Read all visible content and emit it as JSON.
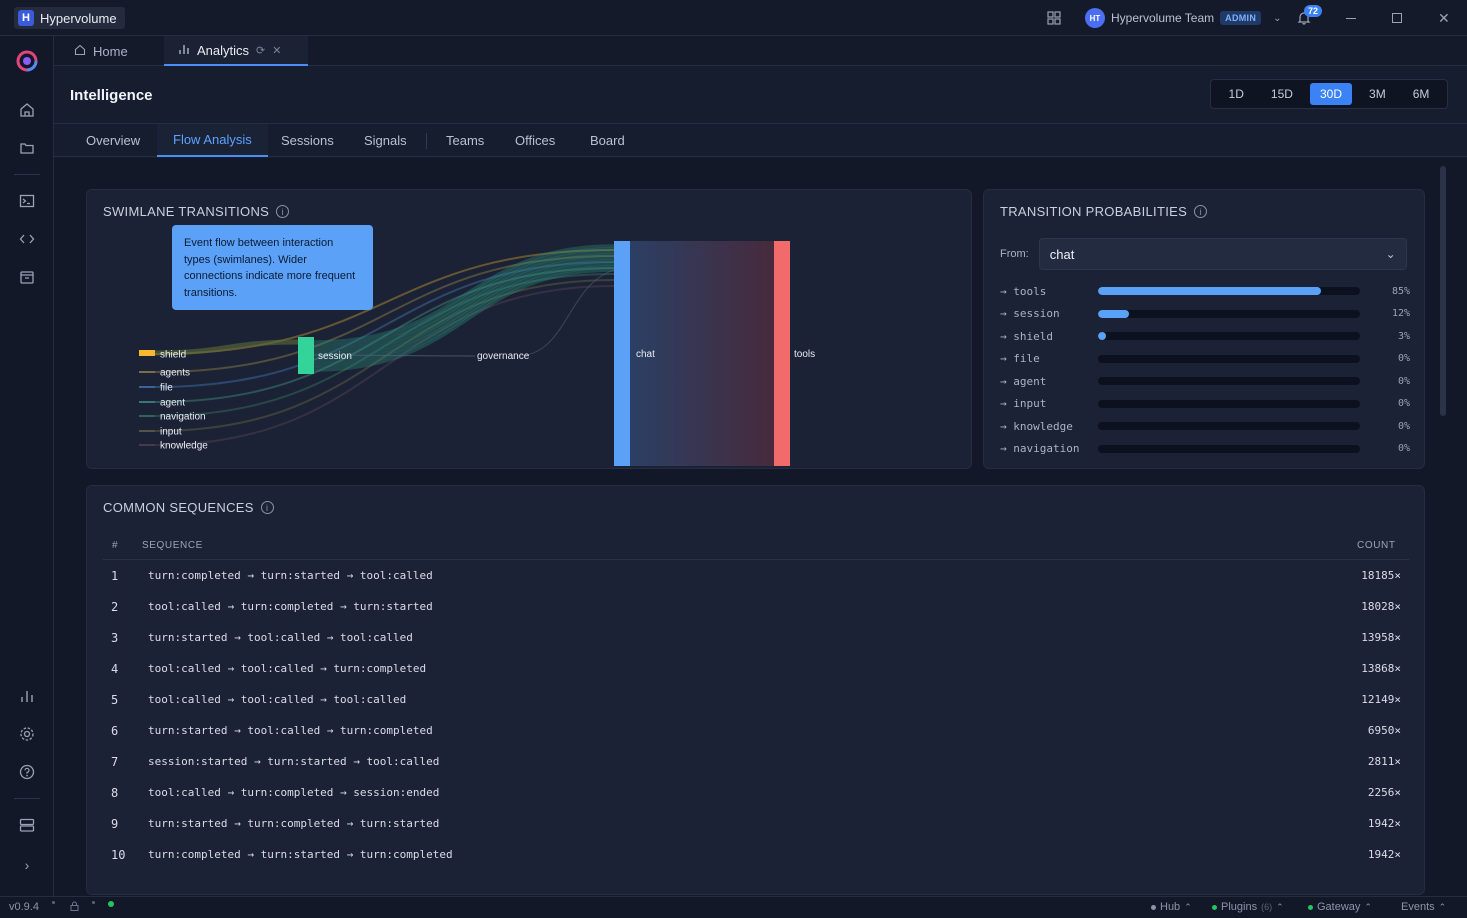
{
  "app": {
    "name": "Hypervolume",
    "logo_letter": "H"
  },
  "titlebar": {
    "team": "Hypervolume Team",
    "team_initials": "HT",
    "role": "ADMIN",
    "notification_count": "72"
  },
  "tabs": [
    {
      "label": "Home",
      "icon": "home-icon"
    },
    {
      "label": "Analytics",
      "icon": "bar-chart-icon"
    }
  ],
  "page": {
    "title": "Intelligence"
  },
  "range": {
    "options": [
      "1D",
      "15D",
      "30D",
      "3M",
      "6M"
    ],
    "selected": "30D"
  },
  "subtabs": [
    "Overview",
    "Flow Analysis",
    "Sessions",
    "Signals",
    "Teams",
    "Offices",
    "Board"
  ],
  "subtab_active": "Flow Analysis",
  "swimlane": {
    "title": "SWIMLANE TRANSITIONS",
    "tooltip": "Event flow between interaction types (swimlanes). Wider connections indicate more frequent transitions.",
    "legend": [
      {
        "label": "shield",
        "color": "#f5b82e"
      },
      {
        "label": "agents",
        "color": "#b8a14f"
      },
      {
        "label": "file",
        "color": "#4d8fd6"
      },
      {
        "label": "agent",
        "color": "#4fae9b"
      },
      {
        "label": "navigation",
        "color": "#3f8f6b"
      },
      {
        "label": "input",
        "color": "#7a7a4a"
      },
      {
        "label": "knowledge",
        "color": "#6b4c5c"
      }
    ],
    "nodes": {
      "session": "session",
      "governance": "governance",
      "chat": "chat",
      "tools": "tools"
    },
    "node_colors": {
      "session": "#34d399",
      "chat": "#5aa1f7",
      "tools": "#f26b6b"
    }
  },
  "probabilities": {
    "title": "TRANSITION PROBABILITIES",
    "from_label": "From:",
    "from_value": "chat",
    "rows": [
      {
        "name": "→ tools",
        "pct": "85%",
        "value": 0.85
      },
      {
        "name": "→ session",
        "pct": "12%",
        "value": 0.12
      },
      {
        "name": "→ shield",
        "pct": "3%",
        "value": 0.03
      },
      {
        "name": "→ file",
        "pct": "0%",
        "value": 0
      },
      {
        "name": "→ agent",
        "pct": "0%",
        "value": 0
      },
      {
        "name": "→ input",
        "pct": "0%",
        "value": 0
      },
      {
        "name": "→ knowledge",
        "pct": "0%",
        "value": 0
      },
      {
        "name": "→ navigation",
        "pct": "0%",
        "value": 0
      }
    ]
  },
  "sequences": {
    "title": "COMMON SEQUENCES",
    "headers": {
      "num": "#",
      "seq": "SEQUENCE",
      "count": "COUNT"
    },
    "rows": [
      {
        "n": "1",
        "seq": "turn:completed → turn:started → tool:called",
        "count": "18185×"
      },
      {
        "n": "2",
        "seq": "tool:called → turn:completed → turn:started",
        "count": "18028×"
      },
      {
        "n": "3",
        "seq": "turn:started → tool:called → tool:called",
        "count": "13958×"
      },
      {
        "n": "4",
        "seq": "tool:called → tool:called → turn:completed",
        "count": "13868×"
      },
      {
        "n": "5",
        "seq": "tool:called → tool:called → tool:called",
        "count": "12149×"
      },
      {
        "n": "6",
        "seq": "turn:started → tool:called → turn:completed",
        "count": "6950×"
      },
      {
        "n": "7",
        "seq": "session:started → turn:started → tool:called",
        "count": "2811×"
      },
      {
        "n": "8",
        "seq": "tool:called → turn:completed → session:ended",
        "count": "2256×"
      },
      {
        "n": "9",
        "seq": "turn:started → turn:completed → turn:started",
        "count": "1942×"
      },
      {
        "n": "10",
        "seq": "turn:completed → turn:started → turn:completed",
        "count": "1942×"
      }
    ]
  },
  "statusbar": {
    "version": "v0.9.4",
    "hub": "Hub",
    "plugins": "Plugins",
    "plugins_count": "(6)",
    "gateway": "Gateway",
    "events": "Events"
  },
  "colors": {
    "accent": "#3b82f6",
    "bar": "#5aa1f7"
  }
}
